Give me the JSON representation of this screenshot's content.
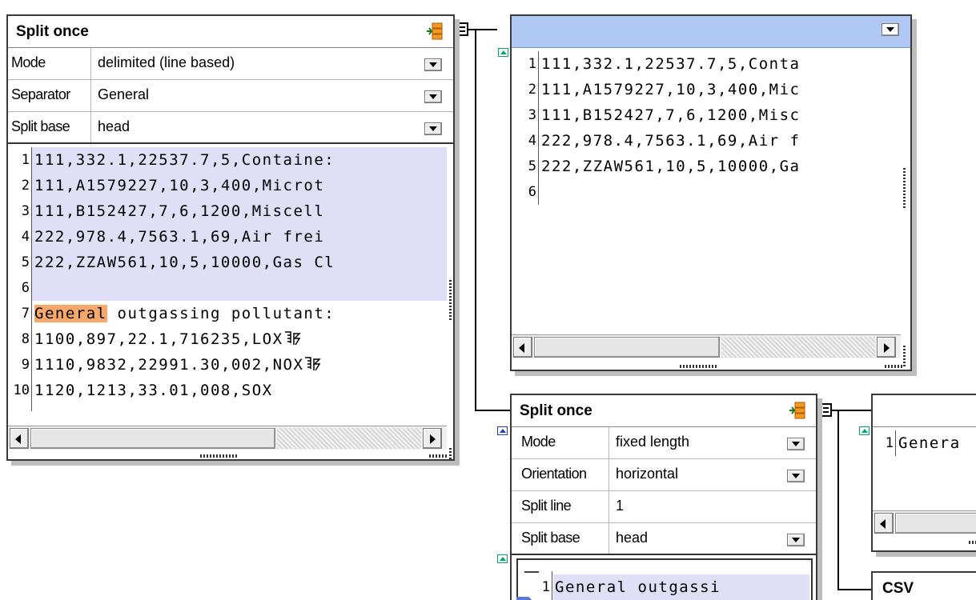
{
  "panel_a": {
    "title": "Split once",
    "rows": [
      {
        "label": "Mode",
        "value": "delimited (line based)"
      },
      {
        "label": "Separator",
        "value": "General"
      },
      {
        "label": "Split base",
        "value": "head"
      }
    ],
    "line_numbers": [
      "1",
      "2",
      "3",
      "4",
      "5",
      "6",
      "7",
      "8",
      "9",
      "10"
    ],
    "lines": [
      "111,332.1,22537.7,5,Containe:",
      "111,A1579227,10,3,400,Microt",
      "111,B152427,7,6,1200,Miscell",
      "222,978.4,7563.1,69,Air frei",
      "222,ZZAW561,10,5,10000,Gas Cl",
      "",
      "General outgassing pollutant:",
      "1100,897,22.1,716235,LOX",
      "1110,9832,22991.30,002,NOX",
      "1120,1213,33.01,008,SOX"
    ],
    "highlight_word": "General",
    "line7_rest": " outgassing pollutant:"
  },
  "panel_b": {
    "line_numbers": [
      "1",
      "2",
      "3",
      "4",
      "5",
      "6"
    ],
    "lines": [
      "111,332.1,22537.7,5,Conta",
      "111,A1579227,10,3,400,Mic",
      "111,B152427,7,6,1200,Misc",
      "222,978.4,7563.1,69,Air f",
      "222,ZZAW561,10,5,10000,Ga",
      ""
    ]
  },
  "panel_c": {
    "title": "Split once",
    "rows": [
      {
        "label": "Mode",
        "value": "fixed length"
      },
      {
        "label": "Orientation",
        "value": "horizontal"
      },
      {
        "label": "Split line",
        "value": "1"
      },
      {
        "label": "Split base",
        "value": "head"
      }
    ],
    "line_numbers": [
      "1"
    ],
    "lines": [
      "General outgassi"
    ]
  },
  "panel_d": {
    "line_numbers": [
      "1"
    ],
    "lines": [
      "Genera"
    ]
  },
  "panel_e": {
    "title": "CSV"
  },
  "colors": {
    "highlight_orange": "#f8a868",
    "selection_lavender": "#dfe0f8",
    "header_blue": "#b0c8f4"
  },
  "icons": {
    "split": "split-icon",
    "line_break": "line-break-icon",
    "dropdown": "dropdown-arrow-icon",
    "connector": "connector-icon",
    "output_marker": "output-marker-icon"
  }
}
